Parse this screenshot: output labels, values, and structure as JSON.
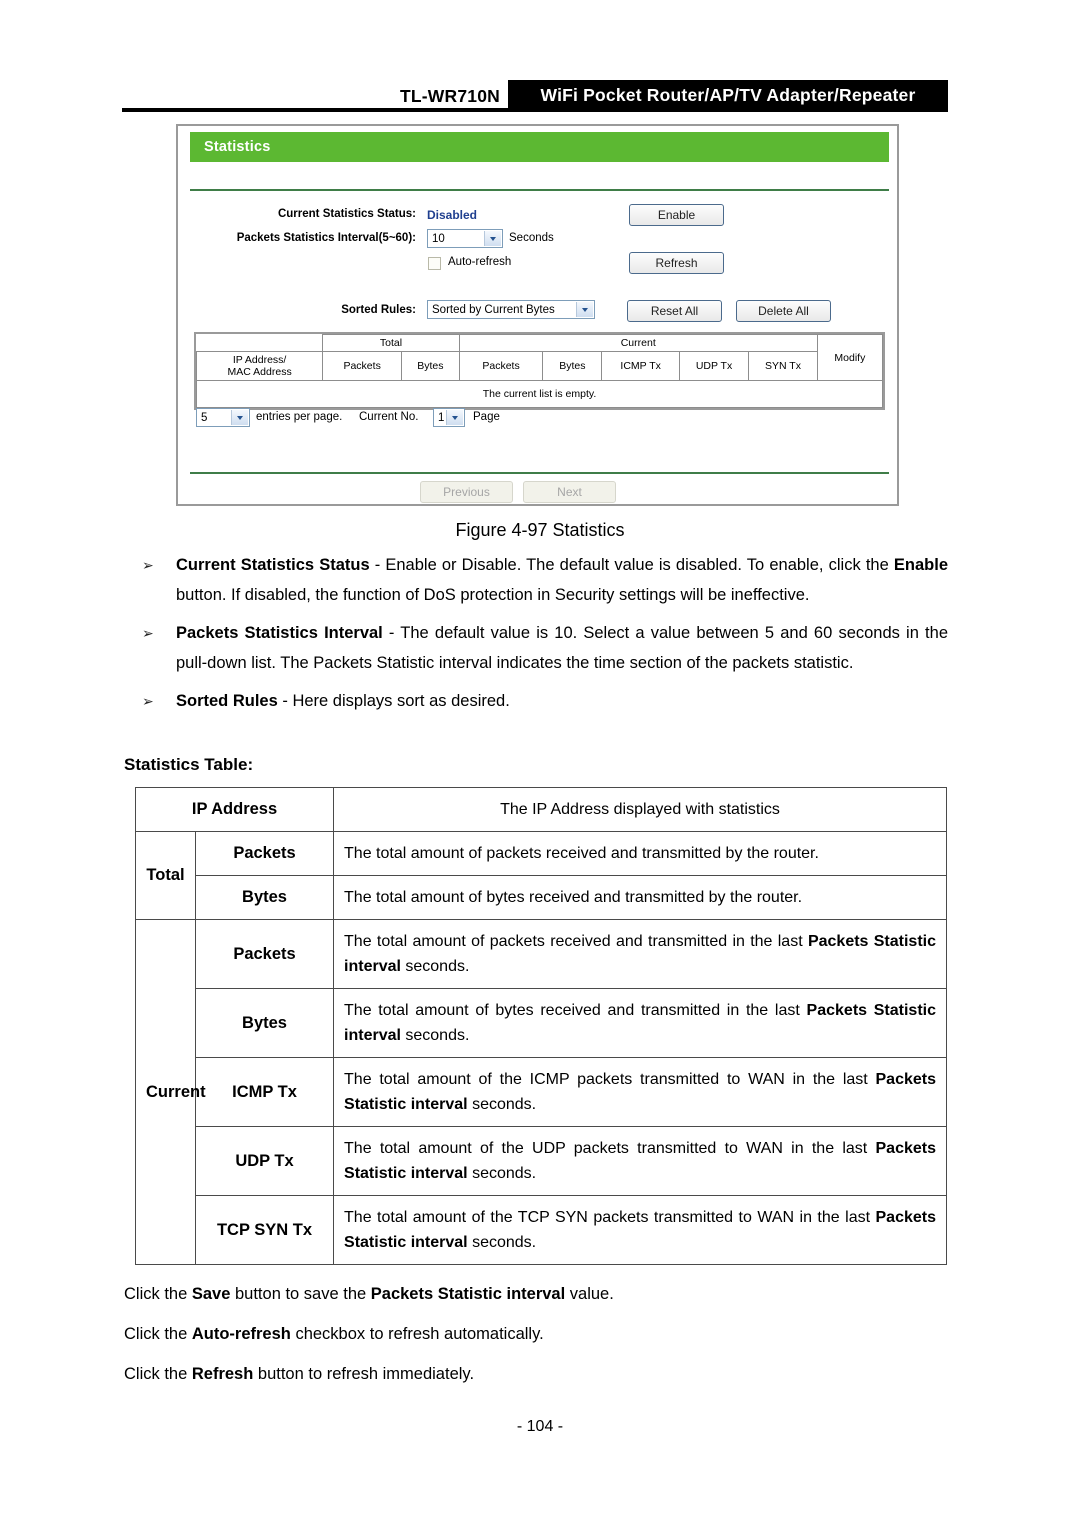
{
  "header": {
    "model": "TL-WR710N",
    "product_banner": "WiFi Pocket Router/AP/TV Adapter/Repeater"
  },
  "screenshot": {
    "panel_title": "Statistics",
    "fields": {
      "status_label": "Current Statistics Status:",
      "status_value": "Disabled",
      "interval_label": "Packets Statistics Interval(5~60):",
      "interval_value": "10",
      "interval_unit": "Seconds",
      "autorefresh_label": "Auto-refresh",
      "sorted_rules_label": "Sorted Rules:",
      "sorted_rules_value": "Sorted by Current Bytes"
    },
    "buttons": {
      "enable": "Enable",
      "refresh": "Refresh",
      "reset_all": "Reset All",
      "delete_all": "Delete All",
      "previous": "Previous",
      "next": "Next"
    },
    "table": {
      "group_blank": "",
      "group_total": "Total",
      "group_current": "Current",
      "col_modify": "Modify",
      "col_ip_line1": "IP Address/",
      "col_ip_line2": "MAC Address",
      "col_total_packets": "Packets",
      "col_total_bytes": "Bytes",
      "col_cur_packets": "Packets",
      "col_cur_bytes": "Bytes",
      "col_icmp_tx": "ICMP Tx",
      "col_udp_tx": "UDP Tx",
      "col_syn_tx": "SYN Tx",
      "empty_message": "The current list is empty."
    },
    "pager": {
      "entries_value": "5",
      "entries_label": "entries per page.",
      "current_no_label": "Current No.",
      "page_value": "1",
      "page_label": "Page"
    },
    "colors": {
      "panel_green": "#5cb832",
      "status_blue": "#1f3f8f",
      "rule_green": "#3f7d48"
    }
  },
  "figure_caption": "Figure 4-97 Statistics",
  "bullets": [
    {
      "marker": "➢",
      "term": "Current Statistics Status",
      "sep": " - ",
      "body_1": "Enable or Disable. The default value is disabled. To enable, click the ",
      "emph": "Enable",
      "body_2": " button. If disabled, the function of DoS protection in Security settings will be ineffective."
    },
    {
      "marker": "➢",
      "term": "Packets Statistics Interval",
      "sep": " - ",
      "body_1": "The default value is 10. Select a value between 5 and 60 seconds in the pull-down list. The Packets Statistic interval indicates the time section of the packets statistic.",
      "emph": "",
      "body_2": ""
    },
    {
      "marker": "➢",
      "term": "Sorted Rules",
      "sep": " - ",
      "body_1": "Here displays sort as desired.",
      "emph": "",
      "body_2": ""
    }
  ],
  "statistics_table_title": "Statistics Table:",
  "statistics_table": {
    "rows": [
      {
        "group": "",
        "name": "IP Address",
        "desc_pre": "The IP Address displayed with statistics",
        "desc_bold": "",
        "desc_post": "",
        "centered": true
      },
      {
        "group": "Total",
        "name": "Packets",
        "desc_pre": "The total amount of packets received and transmitted by the router.",
        "desc_bold": "",
        "desc_post": "",
        "centered": false
      },
      {
        "group": "",
        "name": "Bytes",
        "desc_pre": "The total amount of bytes received and transmitted by the router.",
        "desc_bold": "",
        "desc_post": "",
        "centered": false
      },
      {
        "group": "",
        "name": "Packets",
        "desc_pre": "The total amount of packets received and transmitted in the last ",
        "desc_bold": "Packets Statistic interval",
        "desc_post": " seconds.",
        "centered": false
      },
      {
        "group": "",
        "name": "Bytes",
        "desc_pre": "The total amount of bytes received and transmitted in the last ",
        "desc_bold": "Packets Statistic interval",
        "desc_post": " seconds.",
        "centered": false
      },
      {
        "group": "Current",
        "name": "ICMP Tx",
        "desc_pre": "The total amount of the ICMP packets transmitted to WAN in the last ",
        "desc_bold": "Packets Statistic interval",
        "desc_post": " seconds.",
        "centered": false
      },
      {
        "group": "",
        "name": "UDP Tx",
        "desc_pre": "The total amount of the UDP packets transmitted to WAN in the last ",
        "desc_bold": "Packets Statistic interval",
        "desc_post": " seconds.",
        "centered": false
      },
      {
        "group": "",
        "name": "TCP SYN Tx",
        "desc_pre": "The total amount of the TCP SYN packets transmitted to WAN in the last ",
        "desc_bold": "Packets Statistic interval",
        "desc_post": " seconds.",
        "centered": false
      }
    ],
    "group_labels": {
      "total": "Total",
      "current": "Current"
    }
  },
  "closing_lines": [
    {
      "pre": "Click the ",
      "b1": "Save",
      "mid": " button to save the ",
      "b2": "Packets Statistic interval",
      "post": " value."
    },
    {
      "pre": "Click the ",
      "b1": "Auto-refresh",
      "mid": " checkbox to refresh automatically.",
      "b2": "",
      "post": ""
    },
    {
      "pre": "Click the ",
      "b1": "Refresh",
      "mid": " button to refresh immediately.",
      "b2": "",
      "post": ""
    }
  ],
  "page_number": "- 104 -"
}
